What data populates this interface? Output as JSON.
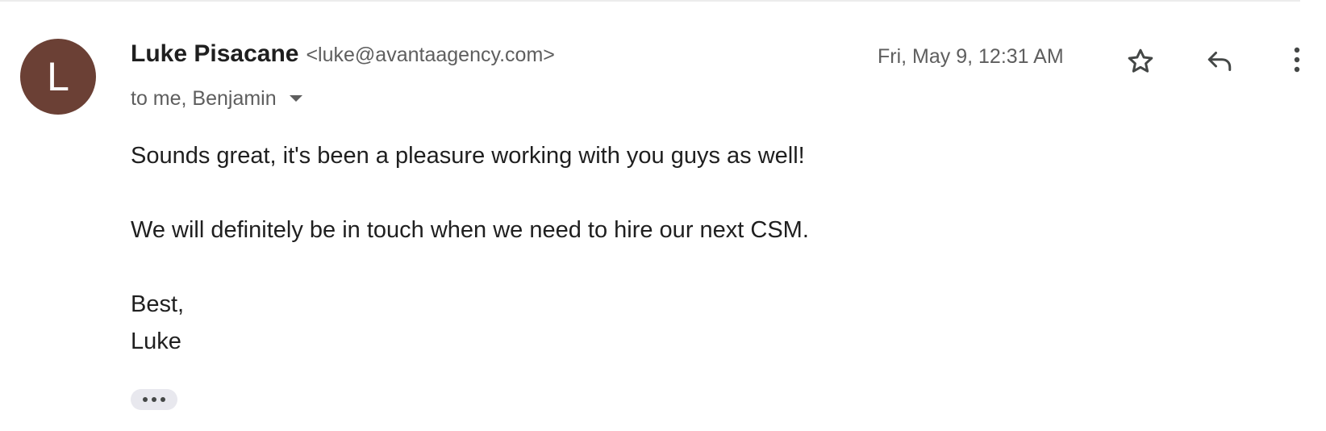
{
  "email": {
    "sender": {
      "avatar_initial": "L",
      "avatar_color": "#6b4035",
      "name": "Luke Pisacane",
      "email_display": "<luke@avantaagency.com>"
    },
    "recipients_text": "to me, Benjamin",
    "timestamp": "Fri, May 9, 12:31 AM",
    "actions": {
      "star_icon": "star-outline-icon",
      "reply_icon": "reply-icon",
      "more_icon": "more-vert-icon"
    },
    "body": {
      "line1": "Sounds great, it's been a pleasure working with you guys as well!",
      "line2": "We will definitely be in touch when we need to hire our next CSM.",
      "closing": "Best,",
      "signature": "Luke"
    },
    "trimmed_content_icon": "more-horiz-icon"
  }
}
